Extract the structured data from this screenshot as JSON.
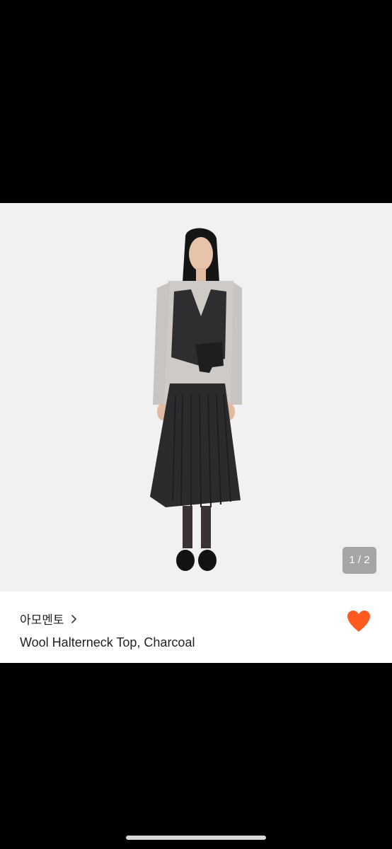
{
  "gallery": {
    "image_alt": "",
    "counter": "1 / 2"
  },
  "product": {
    "brand": "아모멘토",
    "title": "Wool Halterneck Top, Charcoal",
    "favorited": true
  },
  "colors": {
    "background": "#000000",
    "image_bg": "#f1f1f1",
    "counter_bg": "#a5a5a5",
    "heart": "#ff5a1f",
    "text": "#222222"
  },
  "icons": {
    "brand_link": "chevron-right-icon",
    "favorite": "heart-icon"
  }
}
